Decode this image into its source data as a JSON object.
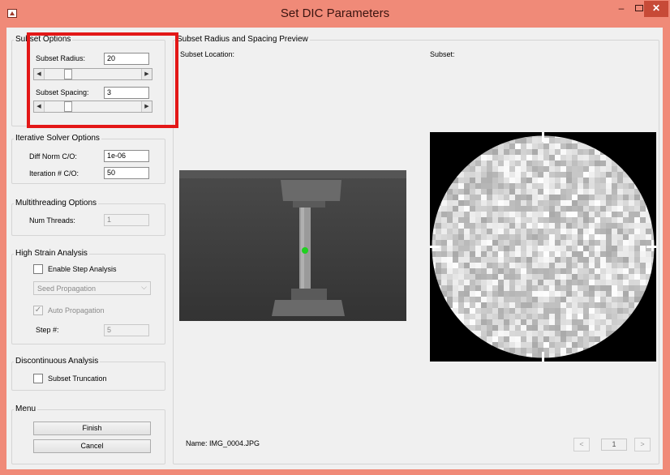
{
  "window": {
    "title": "Set DIC Parameters",
    "icon": "matlab-icon"
  },
  "subset_options": {
    "title": "Subset Options",
    "radius_label": "Subset Radius:",
    "radius_value": "20",
    "spacing_label": "Subset Spacing:",
    "spacing_value": "3",
    "radius_slider_fraction": 0.22,
    "spacing_slider_fraction": 0.22
  },
  "iterative_solver": {
    "title": "Iterative Solver Options",
    "diff_norm_label": "Diff Norm C/O:",
    "diff_norm_value": "1e-06",
    "iteration_label": "Iteration # C/O:",
    "iteration_value": "50"
  },
  "multithreading": {
    "title": "Multithreading Options",
    "num_threads_label": "Num Threads:",
    "num_threads_value": "1"
  },
  "high_strain": {
    "title": "High Strain Analysis",
    "enable_step_label": "Enable Step Analysis",
    "enable_step_checked": false,
    "seed_propagation_value": "Seed Propagation",
    "auto_propagation_label": "Auto Propagation",
    "auto_propagation_checked": true,
    "step_label": "Step #:",
    "step_value": "5"
  },
  "discontinuous": {
    "title": "Discontinuous Analysis",
    "subset_truncation_label": "Subset Truncation",
    "subset_truncation_checked": false
  },
  "menu": {
    "title": "Menu",
    "finish_label": "Finish",
    "cancel_label": "Cancel"
  },
  "preview": {
    "title": "Subset Radius and Spacing Preview",
    "subset_location_label": "Subset Location:",
    "subset_label": "Subset:",
    "image_name": "Name: IMG_0004.JPG",
    "prev_label": "<",
    "page_value": "1",
    "next_label": ">"
  },
  "colors": {
    "titlebar": "#f08a78",
    "highlight": "#e31717",
    "marker": "#1fd11f"
  }
}
